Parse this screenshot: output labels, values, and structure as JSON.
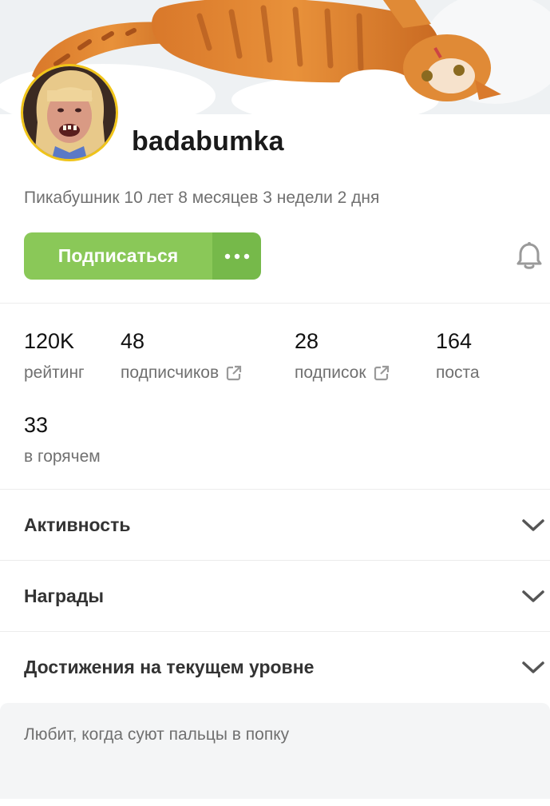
{
  "profile": {
    "username": "badabumka",
    "since": "Пикабушник 10 лет 8 месяцев 3 недели 2 дня"
  },
  "actions": {
    "subscribe_label": "Подписаться",
    "more_icon": "ellipsis-icon",
    "bell_icon": "bell-icon"
  },
  "stats": [
    {
      "value": "120K",
      "label": "рейтинг"
    },
    {
      "value": "48",
      "label": "подписчиков",
      "external": true
    },
    {
      "value": "28",
      "label": "подписок",
      "external": true
    },
    {
      "value": "164",
      "label": "поста"
    },
    {
      "value": "33",
      "label": "в горячем"
    }
  ],
  "sections": [
    {
      "title": "Активность"
    },
    {
      "title": "Награды"
    },
    {
      "title": "Достижения на текущем уровне"
    }
  ],
  "about": {
    "text": "Любит, когда суют пальцы в попку"
  },
  "colors": {
    "accent": "#8ac858",
    "accent_dark": "#76b94a",
    "avatar_border": "#f0c419",
    "muted_text": "#707070"
  }
}
